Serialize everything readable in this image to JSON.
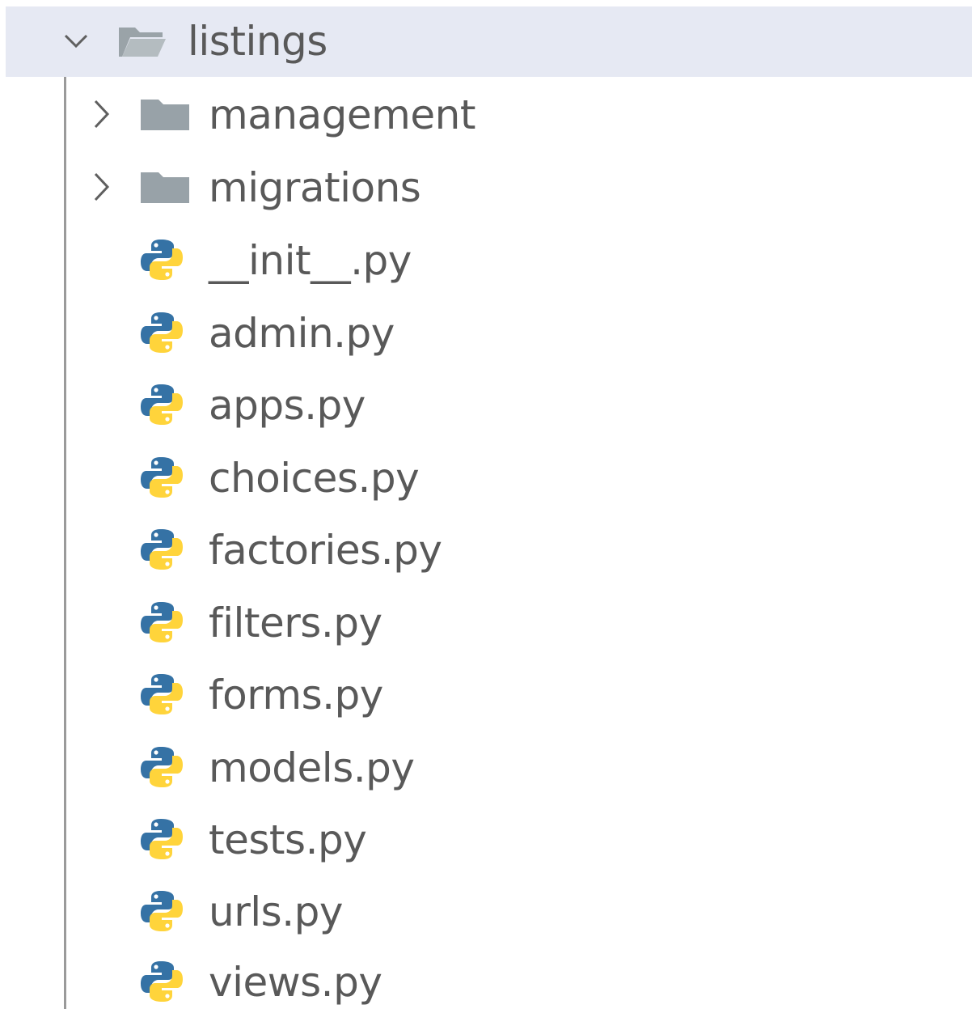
{
  "root_folder": {
    "name": "listings",
    "expanded": true,
    "icons": {
      "chevron": "chevron-down-icon",
      "folder": "folder-open-icon"
    }
  },
  "subfolders": [
    {
      "name": "management",
      "expanded": false,
      "icon": "folder-icon"
    },
    {
      "name": "migrations",
      "expanded": false,
      "icon": "folder-icon"
    }
  ],
  "files": [
    {
      "name": "__init__.py",
      "icon": "python-icon"
    },
    {
      "name": "admin.py",
      "icon": "python-icon"
    },
    {
      "name": "apps.py",
      "icon": "python-icon"
    },
    {
      "name": "choices.py",
      "icon": "python-icon"
    },
    {
      "name": "factories.py",
      "icon": "python-icon"
    },
    {
      "name": "filters.py",
      "icon": "python-icon"
    },
    {
      "name": "forms.py",
      "icon": "python-icon"
    },
    {
      "name": "models.py",
      "icon": "python-icon"
    },
    {
      "name": "tests.py",
      "icon": "python-icon"
    },
    {
      "name": "urls.py",
      "icon": "python-icon"
    },
    {
      "name": "views.py",
      "icon": "python-icon"
    }
  ],
  "colors": {
    "selection": "#e6e9f3",
    "text": "#595959",
    "folder": "#98a2a8",
    "python_blue": "#3572a5",
    "python_yellow": "#ffd43b"
  }
}
